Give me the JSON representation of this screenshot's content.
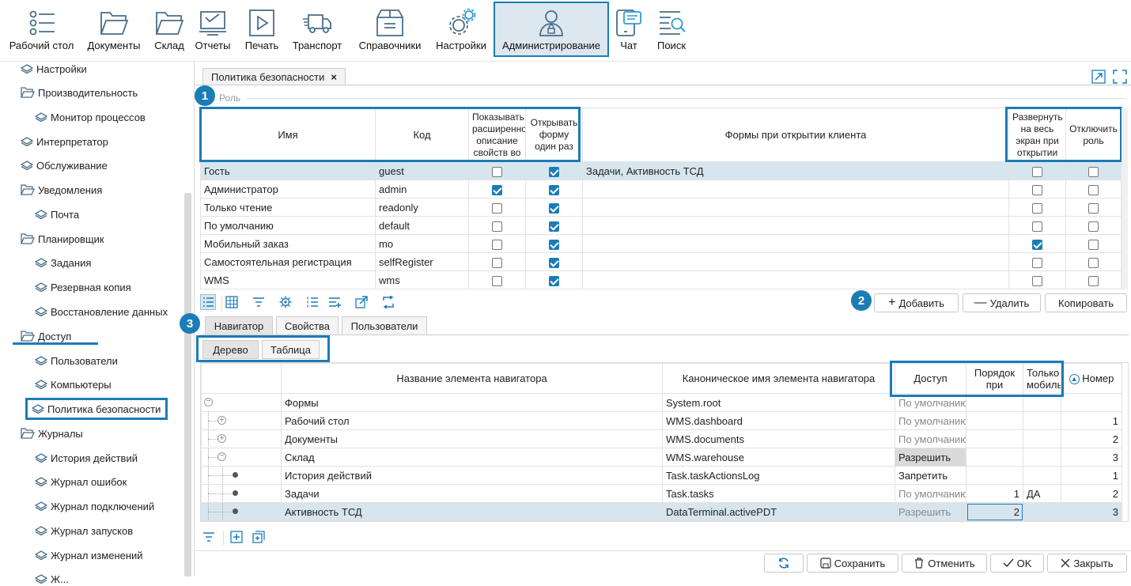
{
  "toolbar": {
    "items": [
      {
        "label": "Рабочий стол",
        "icon": "desktop-list-icon"
      },
      {
        "label": "Документы",
        "icon": "folder-icon"
      },
      {
        "label": "Склад",
        "icon": "folder-icon"
      },
      {
        "label": "Отчеты",
        "icon": "report-icon"
      },
      {
        "label": "Печать",
        "icon": "play-icon"
      },
      {
        "label": "Транспорт",
        "icon": "truck-icon"
      },
      {
        "label": "Справочники",
        "icon": "box-icon"
      },
      {
        "label": "Настройки",
        "icon": "gear-icon"
      },
      {
        "label": "Администрирование",
        "icon": "admin-user-icon"
      },
      {
        "label": "Чат",
        "icon": "chat-icon"
      },
      {
        "label": "Поиск",
        "icon": "search-icon"
      }
    ]
  },
  "sidebar": {
    "items": [
      {
        "label": "Настройки",
        "type": "diamond"
      },
      {
        "label": "Производительность",
        "type": "folder"
      },
      {
        "label": "Монитор процессов",
        "type": "diamond"
      },
      {
        "label": "Интерпретатор",
        "type": "diamond"
      },
      {
        "label": "Обслуживание",
        "type": "diamond"
      },
      {
        "label": "Уведомления",
        "type": "folder"
      },
      {
        "label": "Почта",
        "type": "diamond"
      },
      {
        "label": "Планировщик",
        "type": "folder"
      },
      {
        "label": "Задания",
        "type": "diamond"
      },
      {
        "label": "Резервная копия",
        "type": "diamond"
      },
      {
        "label": "Восстановление данных",
        "type": "diamond"
      },
      {
        "label": "Доступ",
        "type": "folder"
      },
      {
        "label": "Пользователи",
        "type": "diamond"
      },
      {
        "label": "Компьютеры",
        "type": "diamond"
      },
      {
        "label": "Политика безопасности",
        "type": "diamond"
      },
      {
        "label": "Журналы",
        "type": "folder"
      },
      {
        "label": "История действий",
        "type": "diamond"
      },
      {
        "label": "Журнал ошибок",
        "type": "diamond"
      },
      {
        "label": "Журнал подключений",
        "type": "diamond"
      },
      {
        "label": "Журнал запусков",
        "type": "diamond"
      },
      {
        "label": "Журнал изменений",
        "type": "diamond"
      },
      {
        "label": "Ж...",
        "type": "diamond"
      }
    ]
  },
  "tab": {
    "title": "Политика безопасности",
    "close": "×"
  },
  "role_group_label": "Роль",
  "badges": [
    "1",
    "2",
    "3"
  ],
  "roles": {
    "headers": [
      "Имя",
      "Код",
      "Показывать расширенное описание свойств во",
      "Открывать форму один раз",
      "Формы при открытии клиента",
      "Развернуть на весь экран при открытии",
      "Отключить роль"
    ],
    "rows": [
      {
        "name": "Гость",
        "code": "guest",
        "ext": false,
        "once": true,
        "forms": "Задачи, Активность ТСД",
        "full": false,
        "off": false
      },
      {
        "name": "Администратор",
        "code": "admin",
        "ext": true,
        "once": true,
        "forms": "",
        "full": false,
        "off": false
      },
      {
        "name": "Только чтение",
        "code": "readonly",
        "ext": false,
        "once": true,
        "forms": "",
        "full": false,
        "off": false
      },
      {
        "name": "По умолчанию",
        "code": "default",
        "ext": false,
        "once": true,
        "forms": "",
        "full": false,
        "off": false
      },
      {
        "name": "Мобильный заказ",
        "code": "mo",
        "ext": false,
        "once": true,
        "forms": "",
        "full": true,
        "off": false
      },
      {
        "name": "Самостоятельная регистрация",
        "code": "selfRegister",
        "ext": false,
        "once": true,
        "forms": "",
        "full": false,
        "off": false
      },
      {
        "name": "WMS",
        "code": "wms",
        "ext": false,
        "once": true,
        "forms": "",
        "full": false,
        "off": false
      }
    ]
  },
  "actions": {
    "add": "Добавить",
    "delete": "Удалить",
    "copy": "Копировать"
  },
  "subtabs": [
    "Навигатор",
    "Свойства",
    "Пользователи"
  ],
  "viewtabs": [
    "Дерево",
    "Таблица"
  ],
  "nav": {
    "headers": [
      "Название элемента навигатора",
      "Каноническое имя элемента навигатора",
      "Доступ",
      "Порядок при",
      "Только мобиль",
      "Номер"
    ],
    "rows": [
      {
        "name": "Формы",
        "canon": "System.root",
        "access": "По умолчанию",
        "order": "",
        "mobile": "",
        "num": "",
        "level": 0,
        "node": "minus"
      },
      {
        "name": "Рабочий стол",
        "canon": "WMS.dashboard",
        "access": "По умолчанию",
        "order": "",
        "mobile": "",
        "num": "1",
        "level": 1,
        "node": "plus"
      },
      {
        "name": "Документы",
        "canon": "WMS.documents",
        "access": "По умолчанию",
        "order": "",
        "mobile": "",
        "num": "2",
        "level": 1,
        "node": "plus"
      },
      {
        "name": "Склад",
        "canon": "WMS.warehouse",
        "access": "Разрешить",
        "order": "",
        "mobile": "",
        "num": "3",
        "level": 1,
        "node": "minus"
      },
      {
        "name": "История действий",
        "canon": "Task.taskActionsLog",
        "access": "Запретить",
        "order": "",
        "mobile": "",
        "num": "1",
        "level": 2,
        "node": "dot"
      },
      {
        "name": "Задачи",
        "canon": "Task.tasks",
        "access": "По умолчанию",
        "order": "1",
        "mobile": "ДА",
        "num": "2",
        "level": 2,
        "node": "dot"
      },
      {
        "name": "Активность ТСД",
        "canon": "DataTerminal.activePDT",
        "access": "Разрешить",
        "order": "2",
        "mobile": "",
        "num": "3",
        "level": 2,
        "node": "dot"
      }
    ]
  },
  "footer": {
    "save": "Сохранить",
    "cancel": "Отменить",
    "ok": "OK",
    "close": "Закрыть"
  },
  "colors": {
    "accent": "#1b7cb8",
    "selected_row": "#d7e6ee",
    "icon": "#4a6e8a"
  }
}
